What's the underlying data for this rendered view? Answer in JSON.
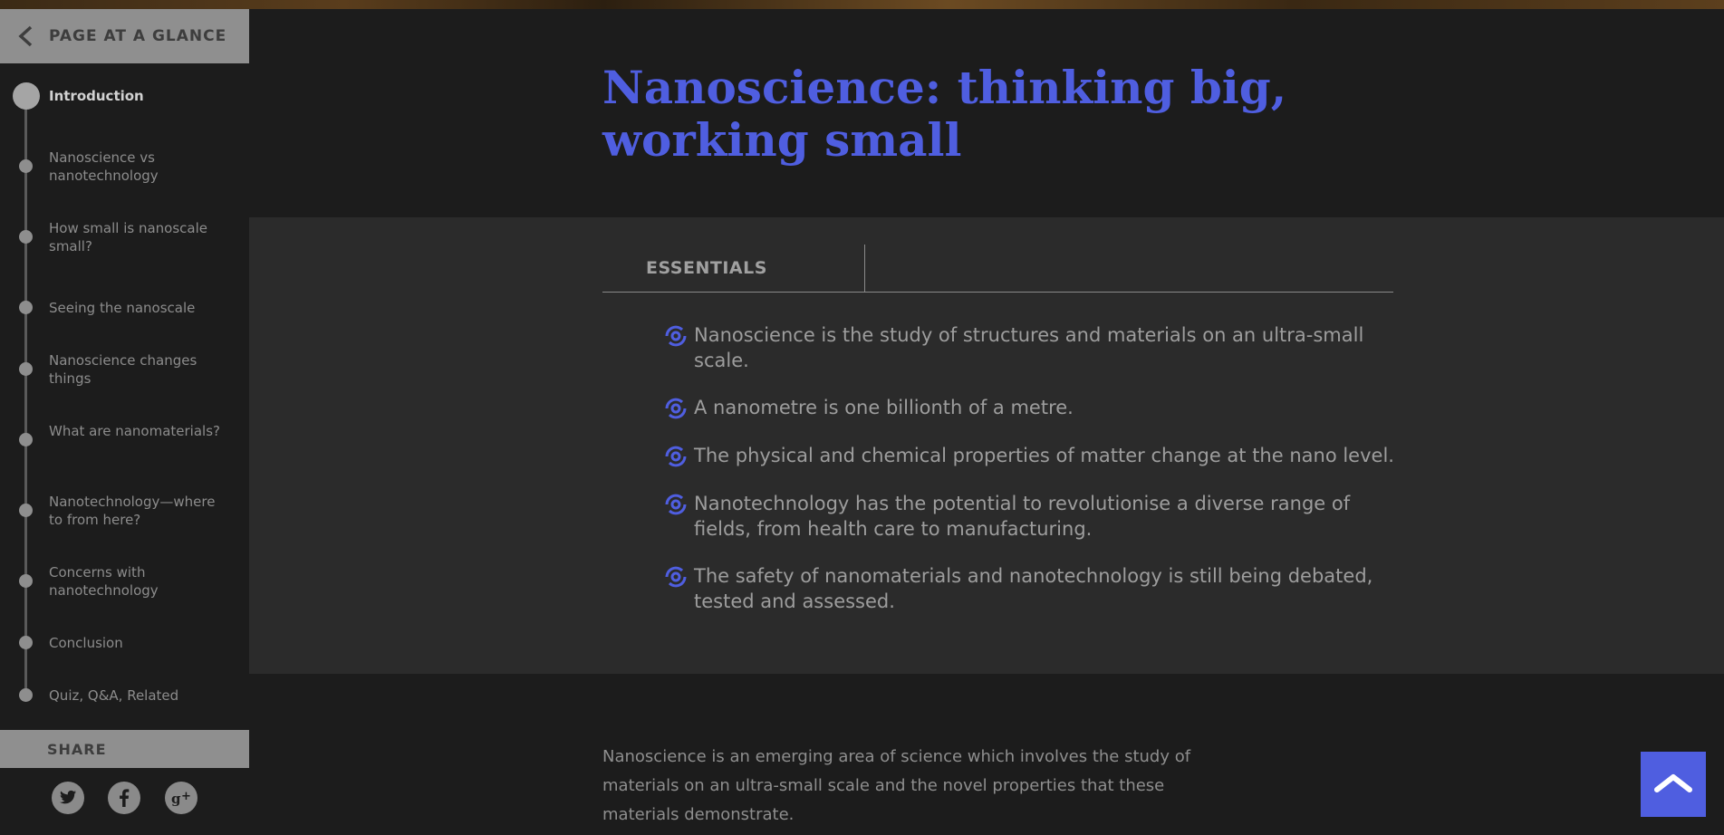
{
  "sidebar": {
    "header_label": "PAGE AT A GLANCE",
    "toc": [
      {
        "label": "Introduction",
        "active": true
      },
      {
        "label": "Nanoscience vs nanotechnology",
        "active": false
      },
      {
        "label": "How small is nanoscale small?",
        "active": false
      },
      {
        "label": "Seeing the nanoscale",
        "active": false
      },
      {
        "label": "Nanoscience changes things",
        "active": false
      },
      {
        "label": "What are nanomaterials?",
        "active": false
      },
      {
        "label": "Nanotechnology—where to from here?",
        "active": false
      },
      {
        "label": "Concerns with nanotechnology",
        "active": false
      },
      {
        "label": "Conclusion",
        "active": false
      },
      {
        "label": "Quiz, Q&A, Related",
        "active": false
      }
    ],
    "share_label": "SHARE",
    "social_icons": [
      "twitter-icon",
      "facebook-icon",
      "google-plus-icon"
    ]
  },
  "main": {
    "title": "Nanoscience: thinking big, working small",
    "essentials": {
      "tab_label": "ESSENTIALS",
      "items": [
        "Nanoscience is the study of structures and materials on an ultra-small scale.",
        "A nanometre is one billionth of a metre.",
        "The physical and chemical properties of matter change at the nano level.",
        "Nanotechnology has the potential to revolutionise a diverse range of fields, from health care to manufacturing.",
        "The safety of nanomaterials and nanotechnology is still being debated, tested and assessed."
      ]
    },
    "intro_paragraph": "Nanoscience is an emerging area of science which involves the study of materials on an ultra-small scale and the novel properties that these materials demonstrate."
  },
  "colors": {
    "accent": "#4f5ee0",
    "sidebar_header": "#8f8f8f",
    "panel": "#2b2b2b",
    "background": "#1c1c1c"
  }
}
